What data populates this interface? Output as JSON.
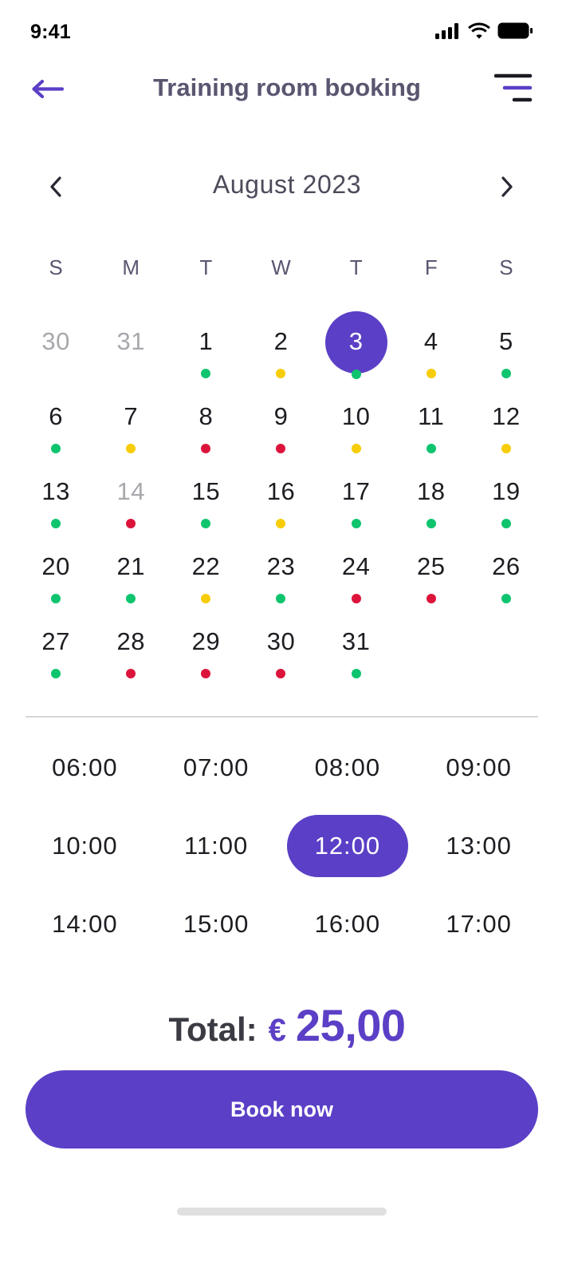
{
  "status_bar": {
    "time": "9:41",
    "icons": [
      "signal-icon",
      "wifi-icon",
      "battery-icon"
    ]
  },
  "header": {
    "title": "Training room booking",
    "back_icon": "arrow-left-icon",
    "filter_icon": "filter-lines-icon"
  },
  "calendar": {
    "month_label": "August 2023",
    "prev_icon": "chevron-left-icon",
    "next_icon": "chevron-right-icon",
    "weekdays": [
      "S",
      "M",
      "T",
      "W",
      "T",
      "F",
      "S"
    ],
    "status_colors": {
      "available": "#0ec46e",
      "limited": "#f6cd07",
      "full": "#dc143c"
    },
    "selected_day": "3",
    "days": [
      {
        "label": "30",
        "muted": true,
        "status": null
      },
      {
        "label": "31",
        "muted": true,
        "status": null
      },
      {
        "label": "1",
        "muted": false,
        "status": "available"
      },
      {
        "label": "2",
        "muted": false,
        "status": "limited"
      },
      {
        "label": "3",
        "muted": false,
        "status": "available",
        "selected": true
      },
      {
        "label": "4",
        "muted": false,
        "status": "limited"
      },
      {
        "label": "5",
        "muted": false,
        "status": "available"
      },
      {
        "label": "6",
        "muted": false,
        "status": "available"
      },
      {
        "label": "7",
        "muted": false,
        "status": "limited"
      },
      {
        "label": "8",
        "muted": false,
        "status": "full"
      },
      {
        "label": "9",
        "muted": false,
        "status": "full"
      },
      {
        "label": "10",
        "muted": false,
        "status": "limited"
      },
      {
        "label": "11",
        "muted": false,
        "status": "available"
      },
      {
        "label": "12",
        "muted": false,
        "status": "limited"
      },
      {
        "label": "13",
        "muted": false,
        "status": "available"
      },
      {
        "label": "14",
        "muted": true,
        "status": "full"
      },
      {
        "label": "15",
        "muted": false,
        "status": "available"
      },
      {
        "label": "16",
        "muted": false,
        "status": "limited"
      },
      {
        "label": "17",
        "muted": false,
        "status": "available"
      },
      {
        "label": "18",
        "muted": false,
        "status": "available"
      },
      {
        "label": "19",
        "muted": false,
        "status": "available"
      },
      {
        "label": "20",
        "muted": false,
        "status": "available"
      },
      {
        "label": "21",
        "muted": false,
        "status": "available"
      },
      {
        "label": "22",
        "muted": false,
        "status": "limited"
      },
      {
        "label": "23",
        "muted": false,
        "status": "available"
      },
      {
        "label": "24",
        "muted": false,
        "status": "full"
      },
      {
        "label": "25",
        "muted": false,
        "status": "full"
      },
      {
        "label": "26",
        "muted": false,
        "status": "available"
      },
      {
        "label": "27",
        "muted": false,
        "status": "available"
      },
      {
        "label": "28",
        "muted": false,
        "status": "full"
      },
      {
        "label": "29",
        "muted": false,
        "status": "full"
      },
      {
        "label": "30",
        "muted": false,
        "status": "full"
      },
      {
        "label": "31",
        "muted": false,
        "status": "available"
      }
    ]
  },
  "time_slots": {
    "selected": "12:00",
    "items": [
      "06:00",
      "07:00",
      "08:00",
      "09:00",
      "10:00",
      "11:00",
      "12:00",
      "13:00",
      "14:00",
      "15:00",
      "16:00",
      "17:00"
    ]
  },
  "total": {
    "label": "Total:",
    "currency": "€",
    "amount": "25,00"
  },
  "book_button": {
    "label": "Book now"
  },
  "colors": {
    "accent": "#5b3fc6",
    "title": "#5a5670",
    "divider": "#d6d6d9"
  }
}
